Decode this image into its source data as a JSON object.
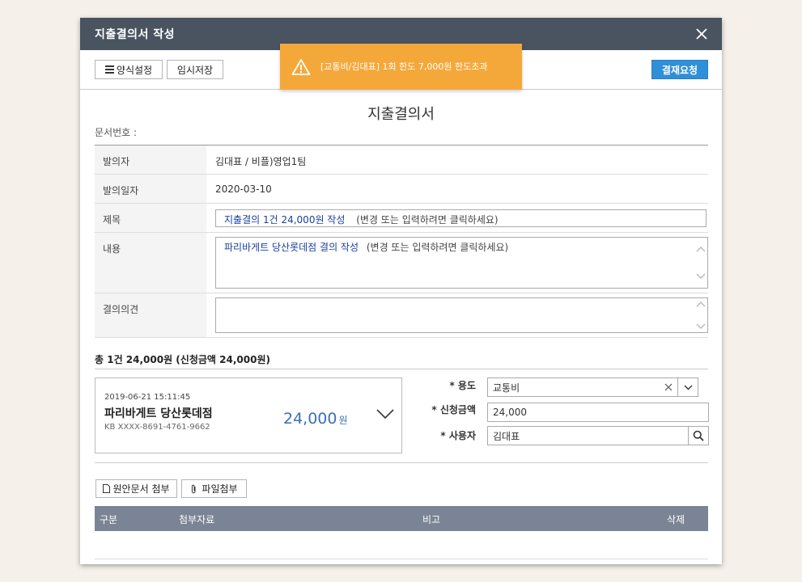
{
  "modal": {
    "title": "지출결의서 작성"
  },
  "toolbar": {
    "format_label": "양식설정",
    "draft_label": "임시저장",
    "submit_label": "결재요청"
  },
  "toast": {
    "message": "[교통비/김대표] 1회 한도 7,000원 한도초과"
  },
  "document": {
    "title": "지출결의서",
    "number_label": "문서번호 :"
  },
  "form": {
    "requester_label": "발의자",
    "requester_value": "김대표 / 비플)영업1팀",
    "date_label": "발의일자",
    "date_value": "2020-03-10",
    "subject_label": "제목",
    "subject_value": "지출결의 1건 24,000원 작성",
    "subject_hint": "(변경 또는 입력하려면 클릭하세요)",
    "content_label": "내용",
    "content_value": "파리바게트 당산롯데점 결의 작성",
    "content_hint": "(변경 또는 입력하려면 클릭하세요)",
    "opinion_label": "결의의견"
  },
  "summary": {
    "text": "총 1건 24,000원 (신청금액 24,000원)"
  },
  "transaction": {
    "datetime": "2019-06-21 15:11:45",
    "merchant": "파리바게트 당산롯데점",
    "card": "KB XXXX-8691-4761-9662",
    "amount": "24,000",
    "currency": "원"
  },
  "details": {
    "purpose_label": "* 용도",
    "purpose_value": "교통비",
    "amount_label": "* 신청금액",
    "amount_value": "24,000",
    "user_label": "* 사용자",
    "user_value": "김대표"
  },
  "attachments": {
    "original_doc_label": "원안문서 첨부",
    "file_attach_label": "파일첨부",
    "columns": [
      "구분",
      "첨부자료",
      "비고",
      "삭제"
    ]
  },
  "colors": {
    "header": "#4a5360",
    "toast": "#f5a83a",
    "primary": "#2f8fd8",
    "amount": "#3a6fb8",
    "table_head": "#7b8494"
  }
}
